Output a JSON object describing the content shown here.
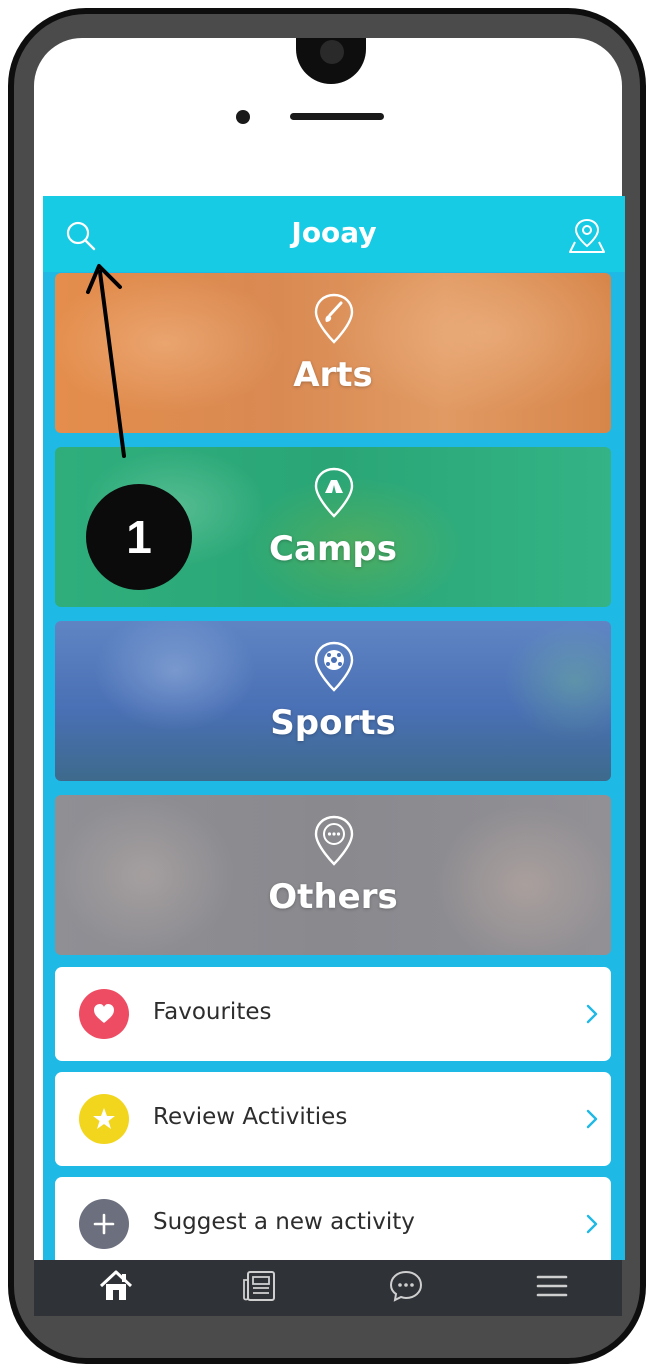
{
  "app": {
    "title": "Jooay"
  },
  "categories": [
    {
      "label": "Arts",
      "icon": "paintbrush-pin-icon",
      "color": "#e48d4c"
    },
    {
      "label": "Camps",
      "icon": "tent-pin-icon",
      "color": "#2fae7c"
    },
    {
      "label": "Sports",
      "icon": "soccer-ball-pin-icon",
      "color": "#4a70b5"
    },
    {
      "label": "Others",
      "icon": "ellipsis-pin-icon",
      "color": "#8f8f94"
    }
  ],
  "menu": [
    {
      "label": "Favourites",
      "icon": "heart-icon",
      "icon_color": "#ee4c63"
    },
    {
      "label": "Review Activities",
      "icon": "star-icon",
      "icon_color": "#f2d51d"
    },
    {
      "label": "Suggest a new activity",
      "icon": "plus-icon",
      "icon_color": "#6b6f7e"
    }
  ],
  "tabbar": {
    "items": [
      {
        "icon": "home-icon"
      },
      {
        "icon": "newspaper-icon"
      },
      {
        "icon": "chat-bubble-icon"
      },
      {
        "icon": "hamburger-menu-icon"
      }
    ]
  },
  "annotation": {
    "badge": "1"
  },
  "colors": {
    "header": "#16cbe3",
    "app_bg": "#1fb9e6",
    "tabbar": "#2f3237",
    "chevron": "#1fb9e6"
  }
}
